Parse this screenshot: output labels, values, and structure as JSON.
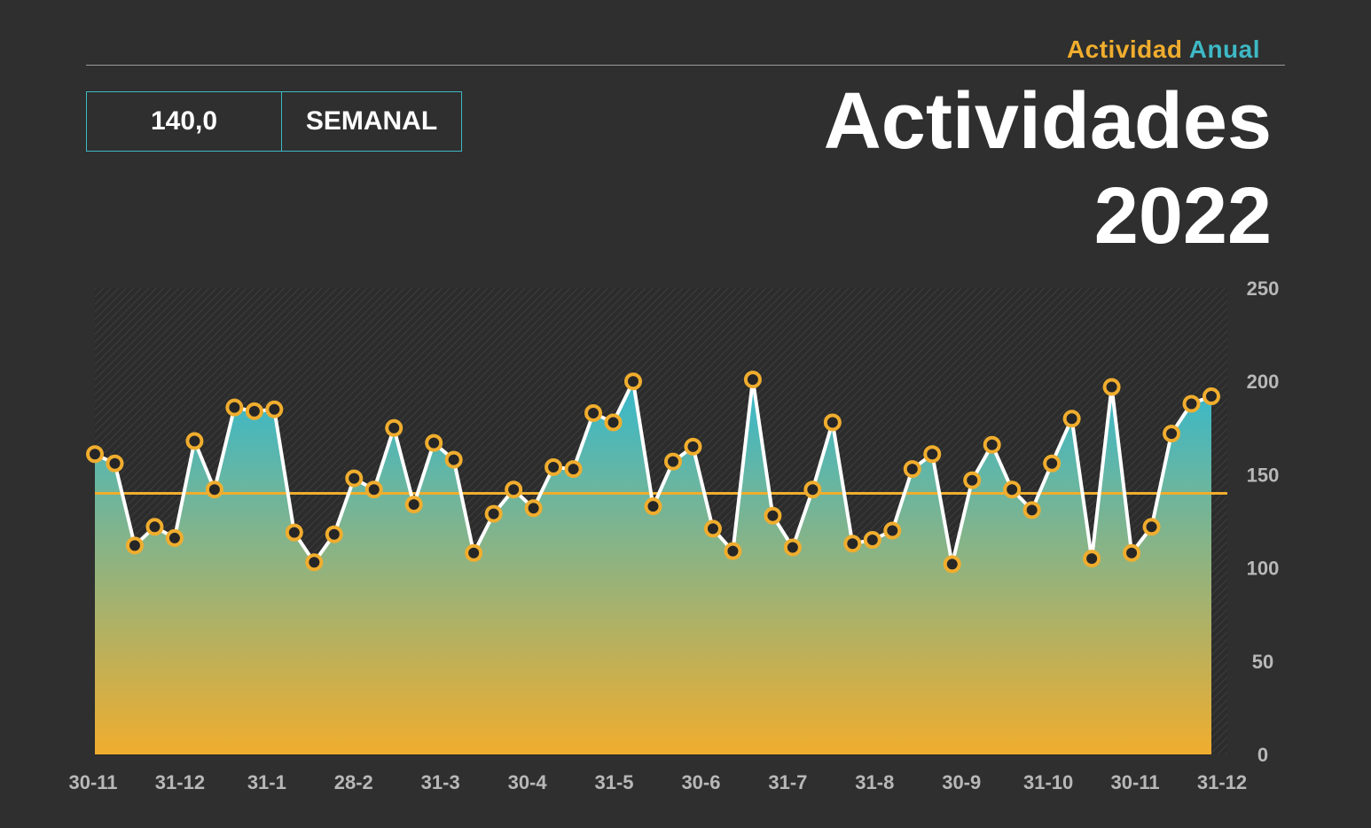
{
  "header": {
    "subtitle_part1": "Actividad",
    "subtitle_part2": "Anual",
    "title_line1": "Actividades",
    "title_line2": "2022"
  },
  "kpi": {
    "value": "140,0",
    "period": "SEMANAL"
  },
  "colors": {
    "background": "#2e2f2e",
    "accent_orange": "#f0ad2e",
    "accent_teal": "#3eb8c5",
    "line": "#ffffff",
    "marker_fill": "#262626"
  },
  "chart_data": {
    "type": "area",
    "x_tick_labels": [
      "30-11",
      "31-12",
      "31-1",
      "28-2",
      "31-3",
      "30-4",
      "31-5",
      "30-6",
      "31-7",
      "31-8",
      "30-9",
      "31-10",
      "30-11",
      "31-12"
    ],
    "y_ticks": [
      0,
      50,
      100,
      150,
      200,
      250
    ],
    "ylim": [
      0,
      250
    ],
    "y_axis_position": "right",
    "grid": false,
    "reference_line": 140,
    "series": [
      {
        "values": [
          161,
          156,
          112,
          122,
          116,
          168,
          142,
          186,
          184,
          185,
          119,
          103,
          118,
          148,
          142,
          175,
          134,
          167,
          158,
          108,
          129,
          142,
          132,
          154,
          153,
          183,
          178,
          200,
          133,
          157,
          165,
          121,
          109,
          201,
          128,
          111,
          142,
          178,
          113,
          115,
          120,
          153,
          161,
          102,
          147,
          166,
          142,
          131,
          156,
          180,
          105,
          197,
          108,
          122,
          172,
          188,
          192
        ]
      }
    ]
  }
}
